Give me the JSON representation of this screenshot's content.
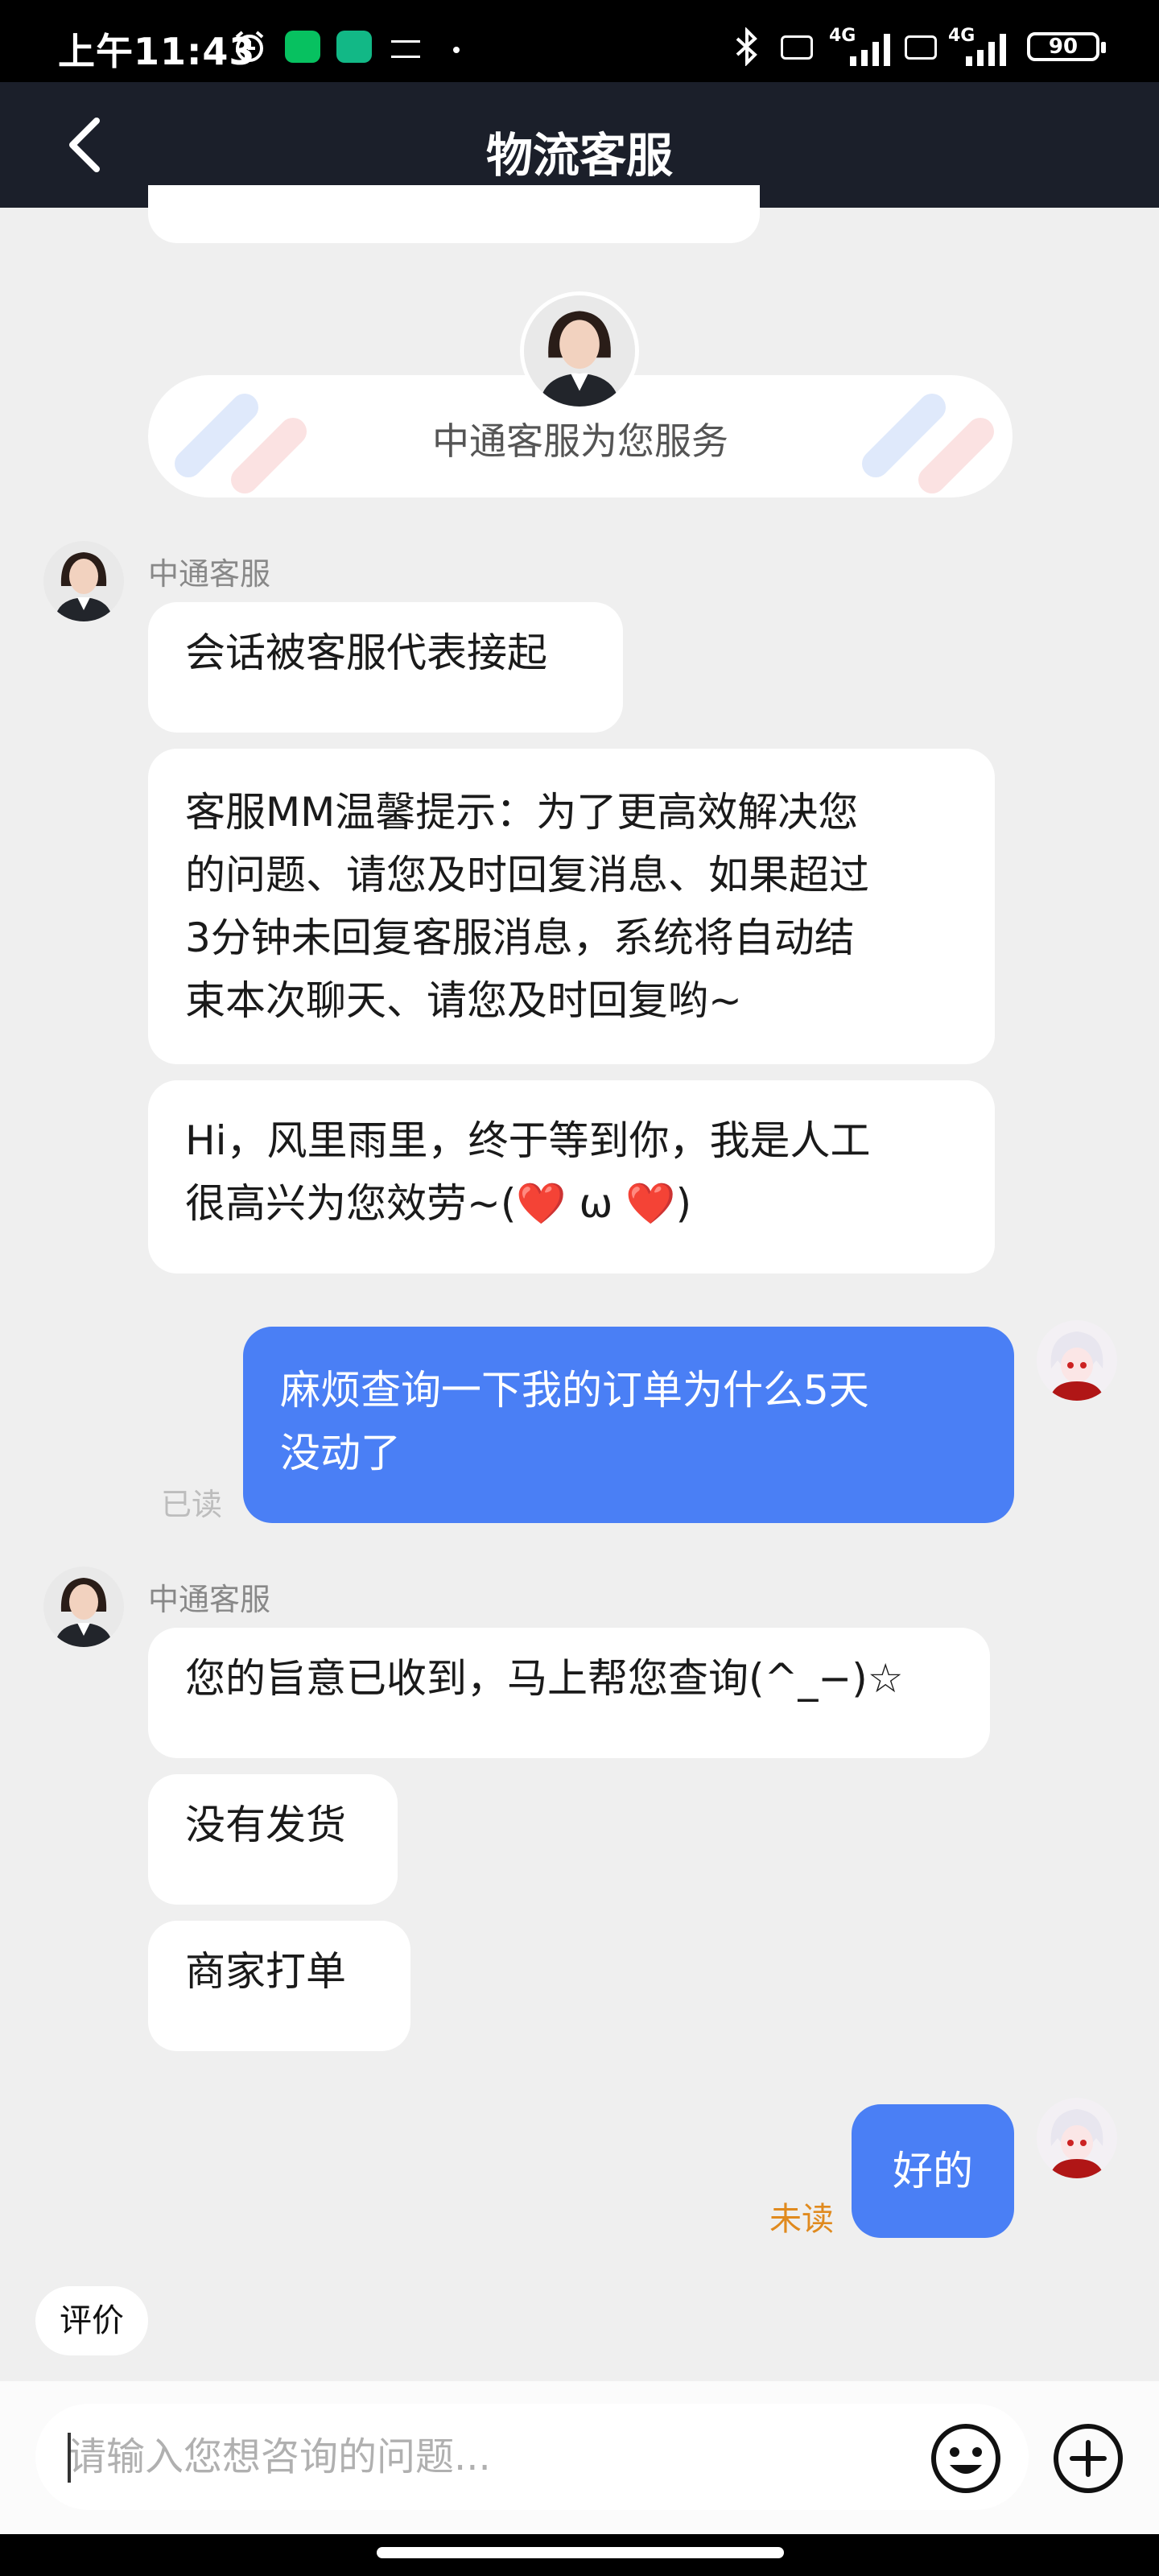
{
  "status_bar": {
    "time": "上午11:43",
    "battery": "90",
    "network": "4G"
  },
  "header": {
    "title": "物流客服"
  },
  "banner": {
    "text": "中通客服为您服务"
  },
  "messages": {
    "group1": {
      "sender": "中通客服",
      "m1": "会话被客服代表接起",
      "m2_l1": "客服MM温馨提示：为了更高效解决您",
      "m2_l2": "的问题、请您及时回复消息、如果超过",
      "m2_l3": "3分钟未回复客服消息，系统将自动结",
      "m2_l4": "束本次聊天、请您及时回复哟~",
      "m3_l1": "Hi，风里雨里，终于等到你，我是人工",
      "m3_l2": "很高兴为您效劳~(❤️ ω ❤️)"
    },
    "user1": {
      "line1": "麻烦查询一下我的订单为什么5天",
      "line2": "没动了",
      "status": "已读"
    },
    "group2": {
      "sender": "中通客服",
      "m1": "您的旨意已收到，马上帮您查询(^_−)☆",
      "m2": "没有发货",
      "m3": "商家打单"
    },
    "user2": {
      "text": "好的",
      "status": "未读"
    }
  },
  "bottom": {
    "rate_label": "评价",
    "input_placeholder": "请输入您想咨询的问题..."
  },
  "colors": {
    "header_bg": "#1b1f2a",
    "user_bubble": "#4a7ff5",
    "unread": "#e08a1e"
  }
}
